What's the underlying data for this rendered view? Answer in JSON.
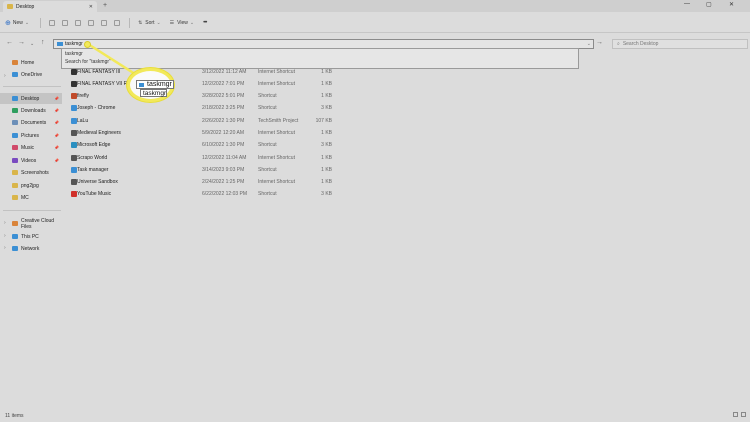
{
  "window": {
    "tab_title": "Desktop",
    "tab_close": "✕",
    "new_tab": "+",
    "min": "—",
    "max": "▢",
    "close": "✕"
  },
  "toolbar": {
    "new_label": "New",
    "sort_label": "Sort",
    "view_label": "View",
    "more_label": "•••"
  },
  "address": {
    "value": "taskmgr",
    "search_placeholder": "Search Desktop"
  },
  "suggestions": [
    "taskmgr",
    "Search for \"taskmgr\""
  ],
  "callout": {
    "field_value": "taskmgr",
    "suggestion": "taskmgr"
  },
  "sidebar": {
    "items": [
      {
        "label": "Home",
        "color": "#d9843a"
      },
      {
        "label": "OneDrive",
        "color": "#3b8fd4"
      },
      {
        "label": "Desktop",
        "color": "#3b8fd4"
      },
      {
        "label": "Downloads",
        "color": "#2f9e5f"
      },
      {
        "label": "Documents",
        "color": "#6c8fb8"
      },
      {
        "label": "Pictures",
        "color": "#3b8fd4"
      },
      {
        "label": "Music",
        "color": "#d04a6a"
      },
      {
        "label": "Videos",
        "color": "#7a4bc0"
      },
      {
        "label": "Screenshots",
        "color": "#d9b54a"
      },
      {
        "label": "png2jpg",
        "color": "#d9b54a"
      },
      {
        "label": "MC",
        "color": "#d9b54a"
      },
      {
        "label": "Creative Cloud Files",
        "color": "#d9843a"
      },
      {
        "label": "This PC",
        "color": "#3b8fd4"
      },
      {
        "label": "Network",
        "color": "#3b8fd4"
      }
    ]
  },
  "files": [
    {
      "name": "FINAL FANTASY III",
      "date": "3/12/2022 11:12 AM",
      "type": "Internet Shortcut",
      "size": "1 KB",
      "color": "#333"
    },
    {
      "name": "FINAL FANTASY VII REMAKE",
      "date": "12/2/2022 7:01 PM",
      "type": "Internet Shortcut",
      "size": "1 KB",
      "color": "#333"
    },
    {
      "name": "firefly",
      "date": "3/28/2022 5:01 PM",
      "type": "Shortcut",
      "size": "1 KB",
      "color": "#c04a2a"
    },
    {
      "name": "Joseph - Chrome",
      "date": "2/18/2022 3:25 PM",
      "type": "Shortcut",
      "size": "3 KB",
      "color": "#3b8fd4"
    },
    {
      "name": "LaLu",
      "date": "2/26/2022 1:30 PM",
      "type": "TechSmith Project",
      "size": "107 KB",
      "color": "#3b8fd4"
    },
    {
      "name": "Medieval Engineers",
      "date": "5/9/2022 12:20 AM",
      "type": "Internet Shortcut",
      "size": "1 KB",
      "color": "#555"
    },
    {
      "name": "Microsoft Edge",
      "date": "6/10/2022 1:30 PM",
      "type": "Shortcut",
      "size": "3 KB",
      "color": "#2a8fc0"
    },
    {
      "name": "Scrapo World",
      "date": "12/2/2022 11:04 AM",
      "type": "Internet Shortcut",
      "size": "1 KB",
      "color": "#555"
    },
    {
      "name": "Task manager",
      "date": "3/14/2023 9:03 PM",
      "type": "Shortcut",
      "size": "1 KB",
      "color": "#3b8fd4"
    },
    {
      "name": "Universe Sandbox",
      "date": "2/24/2022 1:25 PM",
      "type": "Internet Shortcut",
      "size": "1 KB",
      "color": "#555"
    },
    {
      "name": "YouTube Music",
      "date": "6/22/2022 12:03 PM",
      "type": "Shortcut",
      "size": "3 KB",
      "color": "#d0302a"
    }
  ],
  "status": {
    "item_count": "11 items"
  }
}
